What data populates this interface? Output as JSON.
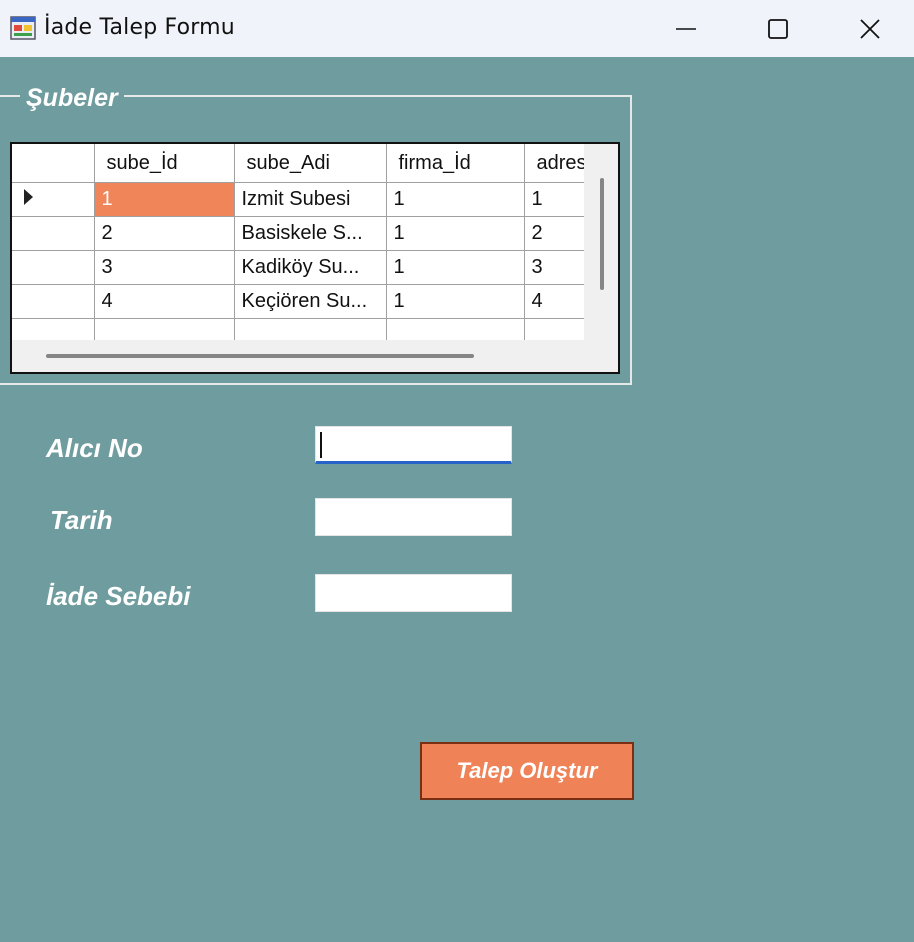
{
  "window": {
    "title": "İade Talep Formu",
    "app_icon": "form-icon",
    "controls": [
      "minimize-icon",
      "maximize-icon",
      "close-icon"
    ]
  },
  "group": {
    "legend": "Şubeler"
  },
  "grid": {
    "columns": [
      "sube_İd",
      "sube_Adi",
      "firma_İd",
      "adres"
    ],
    "rows": [
      [
        "1",
        "Izmit Subesi",
        "1",
        "1"
      ],
      [
        "2",
        "Basiskele S...",
        "1",
        "2"
      ],
      [
        "3",
        "Kadiköy Su...",
        "1",
        "3"
      ],
      [
        "4",
        "Keçiören Su...",
        "1",
        "4"
      ]
    ],
    "selected_cell_color": "#ef8559"
  },
  "form": {
    "alici_label": "Alıcı No",
    "alici_value": "",
    "tarih_label": "Tarih",
    "tarih_value": "",
    "sebep_label": "İade Sebebi",
    "sebep_value": ""
  },
  "actions": {
    "submit_label": "Talep Oluştur"
  },
  "colors": {
    "background": "#6f9c9e",
    "button": "#ef8257",
    "focus_underline": "#2563c9"
  }
}
